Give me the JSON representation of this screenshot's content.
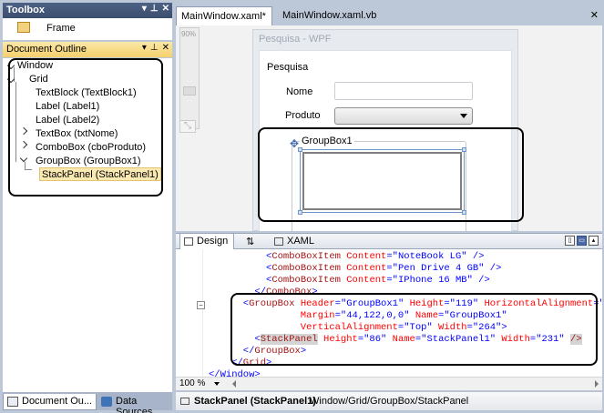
{
  "toolbox": {
    "title": "Toolbox",
    "items": [
      {
        "label": "Frame"
      }
    ]
  },
  "outline": {
    "title": "Document Outline",
    "tree": [
      {
        "label": "Window",
        "level": 0
      },
      {
        "label": "Grid",
        "level": 1
      },
      {
        "label": "TextBlock (TextBlock1)",
        "level": 2
      },
      {
        "label": "Label (Label1)",
        "level": 2
      },
      {
        "label": "Label (Label2)",
        "level": 2
      },
      {
        "label": "TextBox (txtNome)",
        "level": 2
      },
      {
        "label": "ComboBox (cboProduto)",
        "level": 2
      },
      {
        "label": "GroupBox (GroupBox1)",
        "level": 2
      },
      {
        "label": "StackPanel (StackPanel1)",
        "level": 3,
        "selected": true
      }
    ]
  },
  "bottom_tabs": [
    {
      "label": "Document Ou..."
    },
    {
      "label": "Data Sources"
    }
  ],
  "doc_tabs": [
    {
      "label": "MainWindow.xaml*"
    },
    {
      "label": "MainWindow.xaml.vb"
    }
  ],
  "designer": {
    "zoom_label": "90%",
    "window_title": "Pesquisa - WPF",
    "textblock": "Pesquisa",
    "label_nome": "Nome",
    "label_produto": "Produto",
    "groupbox_header": "GroupBox1"
  },
  "split": {
    "design_label": "Design",
    "xaml_label": "XAML"
  },
  "xaml_lines": [
    {
      "indent": 10,
      "parts": [
        [
          "b",
          "<"
        ],
        [
          "t",
          "ComboBoxItem"
        ],
        [
          "a",
          " Content"
        ],
        [
          "b",
          "=\"NoteBook LG\""
        ],
        [
          "b",
          " />"
        ]
      ]
    },
    {
      "indent": 10,
      "parts": [
        [
          "b",
          "<"
        ],
        [
          "t",
          "ComboBoxItem"
        ],
        [
          "a",
          " Content"
        ],
        [
          "b",
          "=\"Pen Drive 4 GB\""
        ],
        [
          "b",
          " />"
        ]
      ]
    },
    {
      "indent": 10,
      "parts": [
        [
          "b",
          "<"
        ],
        [
          "t",
          "ComboBoxItem"
        ],
        [
          "a",
          " Content"
        ],
        [
          "b",
          "=\"IPhone 16 MB\""
        ],
        [
          "b",
          " />"
        ]
      ]
    },
    {
      "indent": 8,
      "parts": [
        [
          "b",
          "</"
        ],
        [
          "t",
          "ComboBox"
        ],
        [
          "b",
          ">"
        ]
      ]
    },
    {
      "indent": 6,
      "parts": [
        [
          "b",
          "<"
        ],
        [
          "t",
          "GroupBox"
        ],
        [
          "a",
          " Header"
        ],
        [
          "b",
          "=\"GroupBox1\""
        ],
        [
          "a",
          " Height"
        ],
        [
          "b",
          "=\"119\""
        ],
        [
          "a",
          " HorizontalAlignment"
        ],
        [
          "b",
          "=\""
        ]
      ]
    },
    {
      "indent": 16,
      "parts": [
        [
          "a",
          "Margin"
        ],
        [
          "b",
          "=\"44,122,0,0\""
        ],
        [
          "a",
          " Name"
        ],
        [
          "b",
          "=\"GroupBox1\""
        ]
      ]
    },
    {
      "indent": 16,
      "parts": [
        [
          "a",
          "VerticalAlignment"
        ],
        [
          "b",
          "=\"Top\""
        ],
        [
          "a",
          " Width"
        ],
        [
          "b",
          "=\"264\""
        ],
        [
          "b",
          ">"
        ]
      ]
    },
    {
      "indent": 8,
      "parts": [
        [
          "b",
          "<"
        ],
        [
          "m",
          "StackPanel"
        ],
        [
          "a",
          " Height"
        ],
        [
          "b",
          "=\"86\""
        ],
        [
          "a",
          " Name"
        ],
        [
          "b",
          "=\"StackPanel1\""
        ],
        [
          "a",
          " Width"
        ],
        [
          "b",
          "=\"231\""
        ],
        [
          "b",
          " "
        ],
        [
          "m",
          "/>"
        ]
      ]
    },
    {
      "indent": 6,
      "parts": [
        [
          "b",
          "</"
        ],
        [
          "t",
          "GroupBox"
        ],
        [
          "b",
          ">"
        ]
      ]
    },
    {
      "indent": 4,
      "parts": [
        [
          "b",
          "</"
        ],
        [
          "t",
          "Grid"
        ],
        [
          "b",
          ">"
        ]
      ]
    },
    {
      "indent": 0,
      "parts": [
        [
          "b",
          "</Window>"
        ]
      ]
    }
  ],
  "xaml_zoom": "100 %",
  "breadcrumb": {
    "selected": "StackPanel (StackPanel1)",
    "path": "Window/Grid/GroupBox/StackPanel"
  },
  "colors": {
    "selection": "#fbe9b2",
    "pane_title": "#3b4e6e",
    "xaml_tag": "#a31515",
    "xaml_attr": "#ff0000",
    "xaml_value": "#0000ff"
  }
}
